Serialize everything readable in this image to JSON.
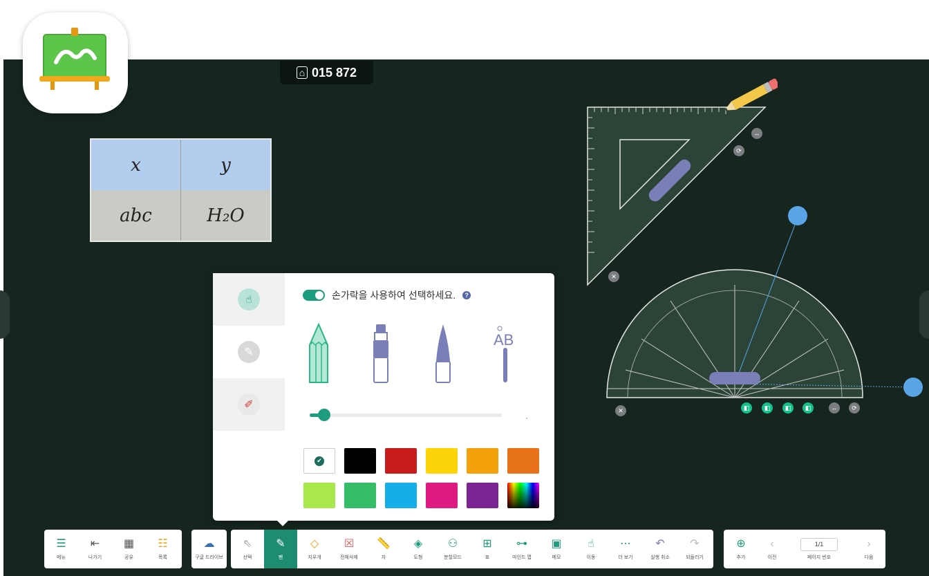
{
  "room_code": "015 872",
  "handwritten_table": {
    "rows": [
      [
        "x",
        "y"
      ],
      [
        "abc",
        "H₂O"
      ]
    ]
  },
  "pen_panel": {
    "finger_select_label": "손가락을 사용하여 선택하세요.",
    "help_icon": "?",
    "mode_tabs": [
      "select-finger",
      "highlighter",
      "eraser-tool"
    ],
    "pen_types": [
      "pencil",
      "marker",
      "brush",
      "text-pen"
    ],
    "text_pen_label": "AB",
    "thickness": 0.07,
    "colors": [
      "#ffffff",
      "#000000",
      "#c91d1d",
      "#fcd40a",
      "#f3a20c",
      "#e8721a",
      "#a9e84b",
      "#35bd68",
      "#16aee8",
      "#df1a82",
      "#7b2595",
      "spectrum"
    ],
    "selected_color": "#ffffff",
    "check_mark": "✔"
  },
  "toolbar": {
    "left": [
      {
        "icon": "menu-icon",
        "glyph": "☰",
        "label": "메뉴"
      },
      {
        "icon": "exit-icon",
        "glyph": "⇤",
        "label": "나가기"
      },
      {
        "icon": "qr-share-icon",
        "glyph": "▦",
        "label": "공유"
      },
      {
        "icon": "list-icon",
        "glyph": "☷",
        "label": "목록"
      }
    ],
    "drive": {
      "icon": "cloud-icon",
      "glyph": "☁",
      "label": "구글 드라이브"
    },
    "main": [
      {
        "icon": "cursor-icon",
        "glyph": "⇖",
        "label": "선택"
      },
      {
        "icon": "pen-icon",
        "glyph": "✎",
        "label": "펜"
      },
      {
        "icon": "eraser-icon",
        "glyph": "◇",
        "label": "지우개"
      },
      {
        "icon": "clear-all-icon",
        "glyph": "☒",
        "label": "전체삭제"
      },
      {
        "icon": "ruler-icon",
        "glyph": "📏",
        "label": "자"
      },
      {
        "icon": "shapes-icon",
        "glyph": "◈",
        "label": "도형"
      },
      {
        "icon": "group-mode-icon",
        "glyph": "⚇",
        "label": "분할모드"
      },
      {
        "icon": "table-icon",
        "glyph": "⊞",
        "label": "표"
      },
      {
        "icon": "mind-map-icon",
        "glyph": "⊶",
        "label": "마인드 맵"
      },
      {
        "icon": "memo-icon",
        "glyph": "▣",
        "label": "메모"
      },
      {
        "icon": "move-hand-icon",
        "glyph": "☝",
        "label": "이동"
      },
      {
        "icon": "more-icon",
        "glyph": "⋯",
        "label": "더 보기"
      },
      {
        "icon": "undo-icon",
        "glyph": "↶",
        "label": "실행 취소"
      },
      {
        "icon": "redo-icon",
        "glyph": "↷",
        "label": "되돌리기"
      }
    ],
    "right": [
      {
        "icon": "add-page-icon",
        "glyph": "⊕",
        "label": "추가"
      },
      {
        "icon": "prev-icon",
        "glyph": "‹",
        "label": "이전"
      },
      {
        "page_number": "1/1",
        "label": "페이지 번호"
      },
      {
        "icon": "next-icon",
        "glyph": "›",
        "label": "다음"
      }
    ]
  },
  "colors": {
    "board": "#16261f",
    "accent": "#1e8c70",
    "handle": "#5aa5e6"
  }
}
